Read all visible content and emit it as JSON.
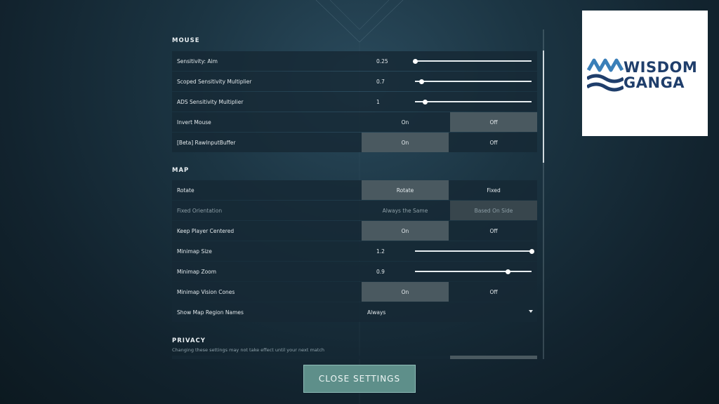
{
  "sections": {
    "mouse": {
      "title": "MOUSE"
    },
    "map": {
      "title": "MAP"
    },
    "privacy": {
      "title": "PRIVACY",
      "subtitle": "Changing these settings may not take effect until your next match"
    }
  },
  "mouse_rows": [
    {
      "label": "Sensitivity: Aim",
      "type": "slider",
      "value": "0.25",
      "fill_fraction": 0.0
    },
    {
      "label": "Scoped Sensitivity Multiplier",
      "type": "slider",
      "value": "0.7",
      "fill_fraction": 0.06
    },
    {
      "label": "ADS Sensitivity Multiplier",
      "type": "slider",
      "value": "1",
      "fill_fraction": 0.09
    },
    {
      "label": "Invert Mouse",
      "type": "toggle",
      "options": [
        "On",
        "Off"
      ],
      "selected": "Off"
    },
    {
      "label": "[Beta] RawInputBuffer",
      "type": "toggle",
      "options": [
        "On",
        "Off"
      ],
      "selected": "On"
    }
  ],
  "map_rows": [
    {
      "label": "Rotate",
      "type": "toggle",
      "options": [
        "Rotate",
        "Fixed"
      ],
      "selected": "Rotate"
    },
    {
      "label": "Fixed Orientation",
      "type": "toggle",
      "options": [
        "Always the Same",
        "Based On Side"
      ],
      "selected": "Based On Side",
      "disabled": true
    },
    {
      "label": "Keep Player Centered",
      "type": "toggle",
      "options": [
        "On",
        "Off"
      ],
      "selected": "On"
    },
    {
      "label": "Minimap Size",
      "type": "slider",
      "value": "1.2",
      "fill_fraction": 1.0
    },
    {
      "label": "Minimap Zoom",
      "type": "slider",
      "value": "0.9",
      "fill_fraction": 0.8
    },
    {
      "label": "Minimap Vision Cones",
      "type": "toggle",
      "options": [
        "On",
        "Off"
      ],
      "selected": "On"
    },
    {
      "label": "Show Map Region Names",
      "type": "dropdown",
      "value": "Always"
    }
  ],
  "close_button": {
    "label": "CLOSE SETTINGS"
  },
  "logo": {
    "line1": "WISDOM",
    "line2": "GANGA",
    "color": "#1f3e6b",
    "accent": "#3a7fb8"
  },
  "colors": {
    "selected_option": "#4a5960",
    "button": "#5e8f8a"
  }
}
